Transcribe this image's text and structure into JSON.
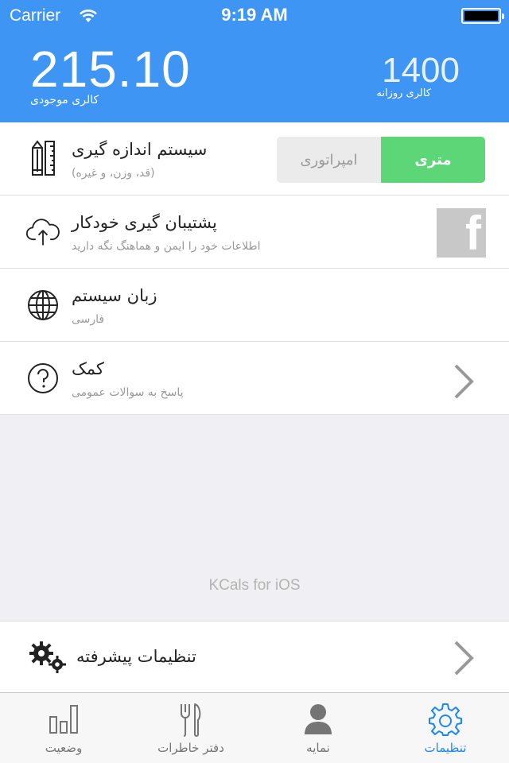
{
  "status_bar": {
    "carrier": "Carrier",
    "time": "9:19 AM"
  },
  "header": {
    "available_calories": "215.10",
    "available_label": "کالری موجودی",
    "daily_calories": "1400",
    "daily_label": "کالری روزانه"
  },
  "settings": {
    "measurement": {
      "title": "سیستم اندازه گیری",
      "subtitle": "(قد، وزن، و غیره)",
      "option_imperial": "امپراتوری",
      "option_metric": "متری",
      "selected": "متری",
      "icon": "ruler-pencil-icon"
    },
    "backup": {
      "title": "پشتیبان گیری خودکار",
      "subtitle": "اطلاعات خود را ایمن و هماهنگ نگه دارید",
      "icon": "cloud-upload-icon",
      "service_icon": "facebook-icon"
    },
    "language": {
      "title": "زبان سیستم",
      "subtitle": "فارسی",
      "icon": "globe-icon"
    },
    "help": {
      "title": "کمک",
      "subtitle": "پاسخ به سوالات عمومی",
      "icon": "question-icon"
    }
  },
  "app_name": "KCals for iOS",
  "advanced": {
    "title": "تنظیمات پیشرفته",
    "icon": "gears-icon"
  },
  "tabs": [
    {
      "label": "وضعیت",
      "icon": "bar-chart-icon"
    },
    {
      "label": "دفتر خاطرات",
      "icon": "fork-knife-icon"
    },
    {
      "label": "نمایه",
      "icon": "person-icon"
    },
    {
      "label": "تنظیمات",
      "icon": "gear-icon",
      "active": true
    }
  ],
  "colors": {
    "header": "#3f95f4",
    "accent": "#1a88f4",
    "selected_segment": "#5cd677"
  }
}
